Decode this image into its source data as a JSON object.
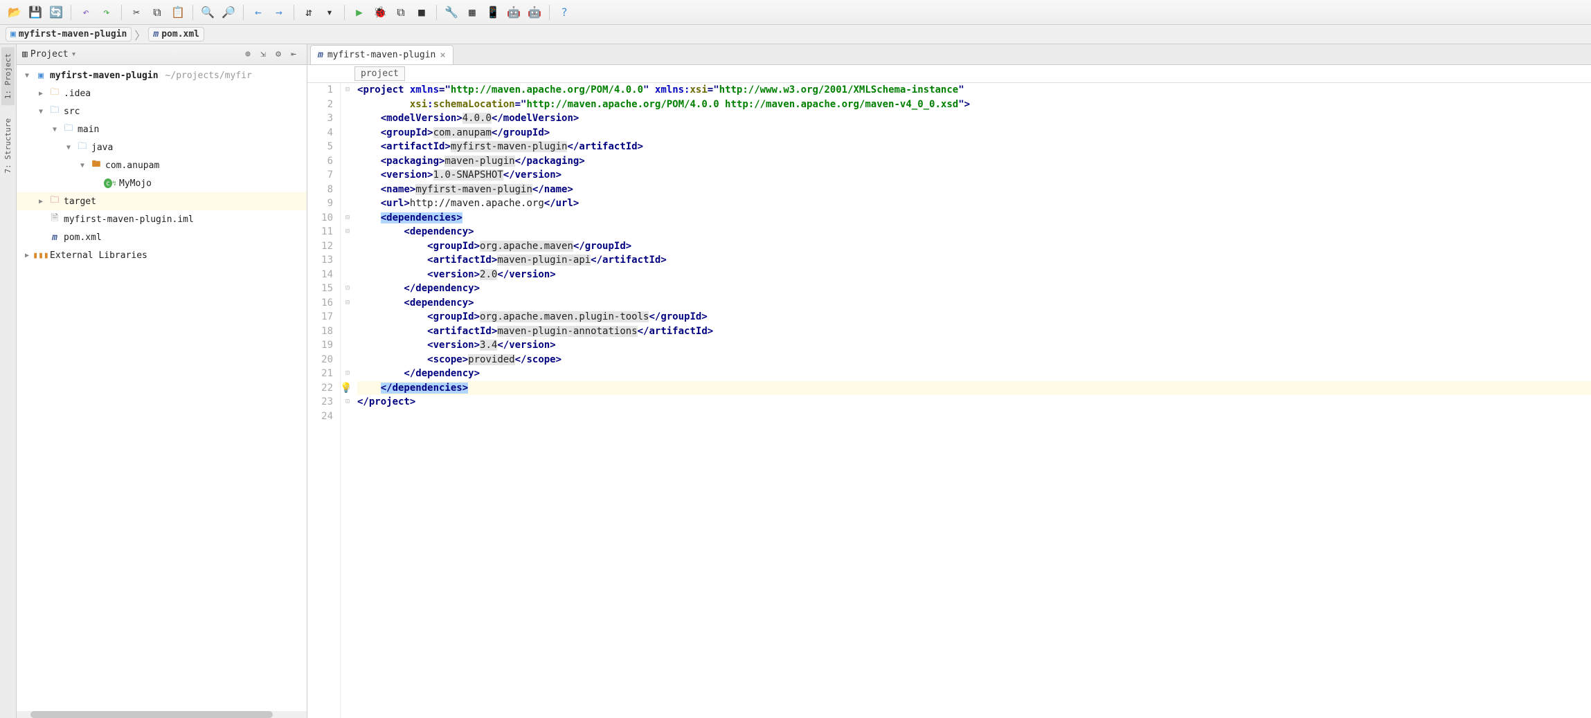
{
  "toolbar": {
    "buttons": [
      "open",
      "save",
      "refresh",
      "|",
      "undo",
      "redo",
      "|",
      "cut",
      "copy",
      "paste",
      "|",
      "zoom-in",
      "zoom-out",
      "|",
      "back",
      "forward",
      "|",
      "sort",
      "dropdown",
      "|",
      "run",
      "debug",
      "debug2",
      "stop",
      "|",
      "wrench",
      "structure",
      "device",
      "android",
      "android2",
      "|",
      "help"
    ]
  },
  "breadcrumb": {
    "items": [
      {
        "icon": "folder",
        "label": "myfirst-maven-plugin"
      },
      {
        "icon": "maven",
        "label": "pom.xml"
      }
    ]
  },
  "sidebar_tabs": [
    {
      "label": "1: Project",
      "active": true
    },
    {
      "label": "7: Structure",
      "active": false
    }
  ],
  "project_panel": {
    "title": "Project",
    "header_buttons": [
      "target",
      "collapse",
      "settings",
      "hide"
    ]
  },
  "tree": [
    {
      "depth": 0,
      "arrow": "down",
      "icon": "module",
      "label": "myfirst-maven-plugin",
      "hint": "~/projects/myfir",
      "bold": true
    },
    {
      "depth": 1,
      "arrow": "right",
      "icon": "folder",
      "label": ".idea"
    },
    {
      "depth": 1,
      "arrow": "down",
      "icon": "folder-src",
      "label": "src"
    },
    {
      "depth": 2,
      "arrow": "down",
      "icon": "folder-src",
      "label": "main"
    },
    {
      "depth": 3,
      "arrow": "down",
      "icon": "folder-src",
      "label": "java"
    },
    {
      "depth": 4,
      "arrow": "down",
      "icon": "package",
      "label": "com.anupam"
    },
    {
      "depth": 5,
      "arrow": "",
      "icon": "class",
      "label": "MyMojo"
    },
    {
      "depth": 1,
      "arrow": "right",
      "icon": "folder-target",
      "label": "target",
      "highlight": true
    },
    {
      "depth": 1,
      "arrow": "",
      "icon": "file",
      "label": "myfirst-maven-plugin.iml"
    },
    {
      "depth": 1,
      "arrow": "",
      "icon": "maven",
      "label": "pom.xml"
    },
    {
      "depth": 0,
      "arrow": "right",
      "icon": "libraries",
      "label": "External Libraries"
    }
  ],
  "editor": {
    "tab": {
      "icon": "maven",
      "label": "myfirst-maven-plugin"
    },
    "bc_chip": "project",
    "cursor_line": 22,
    "lines": [
      {
        "n": 1,
        "segs": [
          {
            "t": "<",
            "c": "tag"
          },
          {
            "t": "project ",
            "c": "tag"
          },
          {
            "t": "xmlns",
            "c": "attr-name"
          },
          {
            "t": "=\"",
            "c": "tag"
          },
          {
            "t": "http://maven.apache.org/POM/4.0.0",
            "c": "attr-val"
          },
          {
            "t": "\" ",
            "c": "tag"
          },
          {
            "t": "xmlns:",
            "c": "attr-name"
          },
          {
            "t": "xsi",
            "c": "ns"
          },
          {
            "t": "=\"",
            "c": "tag"
          },
          {
            "t": "http://www.w3.org/2001/XMLSchema-instance",
            "c": "attr-val"
          },
          {
            "t": "\"",
            "c": "tag"
          }
        ],
        "indent": 0
      },
      {
        "n": 2,
        "segs": [
          {
            "t": "         ",
            "c": "text"
          },
          {
            "t": "xsi",
            "c": "ns"
          },
          {
            "t": ":",
            "c": "attr-name"
          },
          {
            "t": "schemaLocation",
            "c": "ns"
          },
          {
            "t": "=\"",
            "c": "tag"
          },
          {
            "t": "http://maven.apache.org/POM/4.0.0 http://maven.apache.org/maven-v4_0_0.xsd",
            "c": "attr-val"
          },
          {
            "t": "\">",
            "c": "tag"
          }
        ],
        "indent": 0
      },
      {
        "n": 3,
        "segs": [
          {
            "t": "    <",
            "c": "tag"
          },
          {
            "t": "modelVersion",
            "c": "tag"
          },
          {
            "t": ">",
            "c": "tag"
          },
          {
            "t": "4.0.0",
            "c": "text",
            "bg": "hl"
          },
          {
            "t": "</",
            "c": "tag"
          },
          {
            "t": "modelVersion",
            "c": "tag"
          },
          {
            "t": ">",
            "c": "tag"
          }
        ],
        "indent": 0
      },
      {
        "n": 4,
        "segs": [
          {
            "t": "    <",
            "c": "tag"
          },
          {
            "t": "groupId",
            "c": "tag"
          },
          {
            "t": ">",
            "c": "tag"
          },
          {
            "t": "com.anupam",
            "c": "text",
            "bg": "hl"
          },
          {
            "t": "</",
            "c": "tag"
          },
          {
            "t": "groupId",
            "c": "tag"
          },
          {
            "t": ">",
            "c": "tag"
          }
        ],
        "indent": 0
      },
      {
        "n": 5,
        "segs": [
          {
            "t": "    <",
            "c": "tag"
          },
          {
            "t": "artifactId",
            "c": "tag"
          },
          {
            "t": ">",
            "c": "tag"
          },
          {
            "t": "myfirst-maven-plugin",
            "c": "text",
            "bg": "hl"
          },
          {
            "t": "</",
            "c": "tag"
          },
          {
            "t": "artifactId",
            "c": "tag"
          },
          {
            "t": ">",
            "c": "tag"
          }
        ],
        "indent": 0
      },
      {
        "n": 6,
        "segs": [
          {
            "t": "    <",
            "c": "tag"
          },
          {
            "t": "packaging",
            "c": "tag"
          },
          {
            "t": ">",
            "c": "tag"
          },
          {
            "t": "maven-plugin",
            "c": "text",
            "bg": "hl"
          },
          {
            "t": "</",
            "c": "tag"
          },
          {
            "t": "packaging",
            "c": "tag"
          },
          {
            "t": ">",
            "c": "tag"
          }
        ],
        "indent": 0
      },
      {
        "n": 7,
        "segs": [
          {
            "t": "    <",
            "c": "tag"
          },
          {
            "t": "version",
            "c": "tag"
          },
          {
            "t": ">",
            "c": "tag"
          },
          {
            "t": "1.0-SNAPSHOT",
            "c": "text",
            "bg": "hl"
          },
          {
            "t": "</",
            "c": "tag"
          },
          {
            "t": "version",
            "c": "tag"
          },
          {
            "t": ">",
            "c": "tag"
          }
        ],
        "indent": 0
      },
      {
        "n": 8,
        "segs": [
          {
            "t": "    <",
            "c": "tag"
          },
          {
            "t": "name",
            "c": "tag"
          },
          {
            "t": ">",
            "c": "tag"
          },
          {
            "t": "myfirst-maven-plugin",
            "c": "text",
            "bg": "hl"
          },
          {
            "t": "</",
            "c": "tag"
          },
          {
            "t": "name",
            "c": "tag"
          },
          {
            "t": ">",
            "c": "tag"
          }
        ],
        "indent": 0
      },
      {
        "n": 9,
        "segs": [
          {
            "t": "    <",
            "c": "tag"
          },
          {
            "t": "url",
            "c": "tag"
          },
          {
            "t": ">",
            "c": "tag"
          },
          {
            "t": "http://maven.apache.org",
            "c": "text"
          },
          {
            "t": "</",
            "c": "tag"
          },
          {
            "t": "url",
            "c": "tag"
          },
          {
            "t": ">",
            "c": "tag"
          }
        ],
        "indent": 0
      },
      {
        "n": 10,
        "segs": [
          {
            "t": "    ",
            "c": "text"
          },
          {
            "t": "<",
            "c": "tag",
            "bg": "sel"
          },
          {
            "t": "dependencies",
            "c": "tag",
            "bg": "sel"
          },
          {
            "t": ">",
            "c": "tag",
            "bg": "sel"
          }
        ],
        "indent": 0
      },
      {
        "n": 11,
        "segs": [
          {
            "t": "        <",
            "c": "tag"
          },
          {
            "t": "dependency",
            "c": "tag"
          },
          {
            "t": ">",
            "c": "tag"
          }
        ],
        "indent": 0
      },
      {
        "n": 12,
        "segs": [
          {
            "t": "            <",
            "c": "tag"
          },
          {
            "t": "groupId",
            "c": "tag"
          },
          {
            "t": ">",
            "c": "tag"
          },
          {
            "t": "org.apache.maven",
            "c": "text",
            "bg": "hl"
          },
          {
            "t": "</",
            "c": "tag"
          },
          {
            "t": "groupId",
            "c": "tag"
          },
          {
            "t": ">",
            "c": "tag"
          }
        ],
        "indent": 0
      },
      {
        "n": 13,
        "segs": [
          {
            "t": "            <",
            "c": "tag"
          },
          {
            "t": "artifactId",
            "c": "tag"
          },
          {
            "t": ">",
            "c": "tag"
          },
          {
            "t": "maven-plugin-api",
            "c": "text",
            "bg": "hl"
          },
          {
            "t": "</",
            "c": "tag"
          },
          {
            "t": "artifactId",
            "c": "tag"
          },
          {
            "t": ">",
            "c": "tag"
          }
        ],
        "indent": 0
      },
      {
        "n": 14,
        "segs": [
          {
            "t": "            <",
            "c": "tag"
          },
          {
            "t": "version",
            "c": "tag"
          },
          {
            "t": ">",
            "c": "tag"
          },
          {
            "t": "2.0",
            "c": "text",
            "bg": "hl"
          },
          {
            "t": "</",
            "c": "tag"
          },
          {
            "t": "version",
            "c": "tag"
          },
          {
            "t": ">",
            "c": "tag"
          }
        ],
        "indent": 0
      },
      {
        "n": 15,
        "segs": [
          {
            "t": "        </",
            "c": "tag"
          },
          {
            "t": "dependency",
            "c": "tag"
          },
          {
            "t": ">",
            "c": "tag"
          }
        ],
        "indent": 0
      },
      {
        "n": 16,
        "segs": [
          {
            "t": "        <",
            "c": "tag"
          },
          {
            "t": "dependency",
            "c": "tag"
          },
          {
            "t": ">",
            "c": "tag"
          }
        ],
        "indent": 0
      },
      {
        "n": 17,
        "segs": [
          {
            "t": "            <",
            "c": "tag"
          },
          {
            "t": "groupId",
            "c": "tag"
          },
          {
            "t": ">",
            "c": "tag"
          },
          {
            "t": "org.apache.maven.plugin-tools",
            "c": "text",
            "bg": "hl"
          },
          {
            "t": "</",
            "c": "tag"
          },
          {
            "t": "groupId",
            "c": "tag"
          },
          {
            "t": ">",
            "c": "tag"
          }
        ],
        "indent": 0
      },
      {
        "n": 18,
        "segs": [
          {
            "t": "            <",
            "c": "tag"
          },
          {
            "t": "artifactId",
            "c": "tag"
          },
          {
            "t": ">",
            "c": "tag"
          },
          {
            "t": "maven-plugin-annotations",
            "c": "text",
            "bg": "hl"
          },
          {
            "t": "</",
            "c": "tag"
          },
          {
            "t": "artifactId",
            "c": "tag"
          },
          {
            "t": ">",
            "c": "tag"
          }
        ],
        "indent": 0
      },
      {
        "n": 19,
        "segs": [
          {
            "t": "            <",
            "c": "tag"
          },
          {
            "t": "version",
            "c": "tag"
          },
          {
            "t": ">",
            "c": "tag"
          },
          {
            "t": "3.4",
            "c": "text",
            "bg": "hl"
          },
          {
            "t": "</",
            "c": "tag"
          },
          {
            "t": "version",
            "c": "tag"
          },
          {
            "t": ">",
            "c": "tag"
          }
        ],
        "indent": 0
      },
      {
        "n": 20,
        "segs": [
          {
            "t": "            <",
            "c": "tag"
          },
          {
            "t": "scope",
            "c": "tag"
          },
          {
            "t": ">",
            "c": "tag"
          },
          {
            "t": "provided",
            "c": "text",
            "bg": "hl"
          },
          {
            "t": "</",
            "c": "tag"
          },
          {
            "t": "scope",
            "c": "tag"
          },
          {
            "t": ">",
            "c": "tag"
          }
        ],
        "indent": 0
      },
      {
        "n": 21,
        "segs": [
          {
            "t": "        </",
            "c": "tag"
          },
          {
            "t": "dependency",
            "c": "tag"
          },
          {
            "t": ">",
            "c": "tag"
          }
        ],
        "indent": 0,
        "bulb": true
      },
      {
        "n": 22,
        "segs": [
          {
            "t": "    ",
            "c": "text"
          },
          {
            "t": "</",
            "c": "tag",
            "bg": "sel"
          },
          {
            "t": "dependencies",
            "c": "tag",
            "bg": "sel"
          },
          {
            "t": ">",
            "c": "tag",
            "bg": "sel"
          }
        ],
        "indent": 0
      },
      {
        "n": 23,
        "segs": [
          {
            "t": "</",
            "c": "tag"
          },
          {
            "t": "project",
            "c": "tag"
          },
          {
            "t": ">",
            "c": "tag"
          }
        ],
        "indent": 0
      },
      {
        "n": 24,
        "segs": [],
        "indent": 0
      }
    ]
  },
  "icons": {
    "open": "📂",
    "save": "💾",
    "refresh": "🔄",
    "undo": "↶",
    "redo": "↷",
    "cut": "✂",
    "copy": "⧉",
    "paste": "📋",
    "zoom-in": "🔍",
    "zoom-out": "🔎",
    "back": "←",
    "forward": "→",
    "sort": "⇵",
    "dropdown": "▾",
    "run": "▶",
    "debug": "🐞",
    "debug2": "⧉",
    "stop": "■",
    "wrench": "🔧",
    "structure": "▦",
    "device": "📱",
    "android": "🤖",
    "android2": "🤖",
    "help": "?",
    "folder": "📁",
    "maven": "ⓜ",
    "module": "▣",
    "folder-src": "📁",
    "package": "▢",
    "class": "ⓒ",
    "folder-target": "📁",
    "file": "📄",
    "libraries": "📚",
    "target": "⊕",
    "collapse": "⇲",
    "settings": "⚙",
    "hide": "⇤"
  }
}
